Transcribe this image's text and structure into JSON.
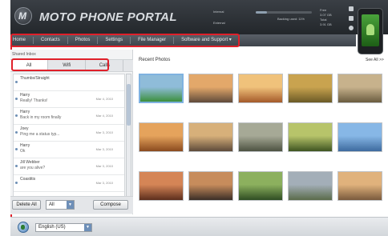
{
  "app": {
    "logo_letter": "M",
    "title": "MOTO PHONE PORTAL"
  },
  "header": {
    "status_label_1": "Internal",
    "status_label_2": "External",
    "meter_text": "Backing used: 11%",
    "meter_fraction": 0.2,
    "storage": [
      "Free",
      "3.07 GB",
      "Total",
      "3.91 GB"
    ]
  },
  "menu": {
    "items": [
      "Home",
      "Contacts",
      "Photos",
      "Settings",
      "File Manager",
      "Software and Support ▾"
    ]
  },
  "messages_pane": {
    "title": "Shared Inbox",
    "tabs": [
      "All",
      "Wifi",
      "Calls"
    ],
    "messages": [
      {
        "name": "Thumbs/Straight",
        "snippet": "",
        "date": ""
      },
      {
        "name": "Harry",
        "snippet": "Really! Thanks!",
        "date": "Mar 4, 2010"
      },
      {
        "name": "Harry",
        "snippet": "Back in my room finally",
        "date": "Mar 4, 2010"
      },
      {
        "name": "Joey",
        "snippet": "Ping me a status typ...",
        "date": "Mar 3, 2010"
      },
      {
        "name": "Harry",
        "snippet": "Ok",
        "date": "Mar 3, 2010"
      },
      {
        "name": "Jill Webber",
        "snippet": "are you alive?",
        "date": "Mar 3, 2010"
      },
      {
        "name": "Coastitis",
        "snippet": "",
        "date": "Mar 3, 2010"
      },
      {
        "name": "",
        "snippet": "",
        "date": ""
      }
    ],
    "delete_all_label": "Delete All",
    "filter_value": "All",
    "compose_label": "Compose"
  },
  "photos": {
    "title": "Recent Photos",
    "see_all": "See All >>",
    "items": [
      {
        "name": "photo-android",
        "colors": [
          "#8fbcd9",
          "#3c8f3c"
        ]
      },
      {
        "name": "photo-dusk-sky",
        "colors": [
          "#e3a86a",
          "#5f4a3a"
        ]
      },
      {
        "name": "photo-city-sunset",
        "colors": [
          "#f0c27b",
          "#a45a2a"
        ]
      },
      {
        "name": "photo-grass-field",
        "colors": [
          "#c9a34f",
          "#6b5a26"
        ]
      },
      {
        "name": "photo-spotted-animal",
        "colors": [
          "#c7b28c",
          "#6a5c3f"
        ]
      },
      {
        "name": "photo-desert-arch",
        "colors": [
          "#e5a35c",
          "#8a4a1e"
        ]
      },
      {
        "name": "photo-tower-city",
        "colors": [
          "#d7b07a",
          "#5d4a3a"
        ]
      },
      {
        "name": "photo-misty-field",
        "colors": [
          "#a6a996",
          "#4d5241"
        ]
      },
      {
        "name": "photo-forest-light",
        "colors": [
          "#b7c46a",
          "#3e5421"
        ]
      },
      {
        "name": "photo-opera-house",
        "colors": [
          "#87b7e6",
          "#3d6a9e"
        ]
      },
      {
        "name": "photo-red-canyon",
        "colors": [
          "#d58556",
          "#5c2e1c"
        ]
      },
      {
        "name": "photo-arches",
        "colors": [
          "#c78c5c",
          "#3a2e26"
        ]
      },
      {
        "name": "photo-daisies",
        "colors": [
          "#8cb05e",
          "#2f4d22"
        ]
      },
      {
        "name": "photo-sky-clouds",
        "colors": [
          "#a3aeb8",
          "#5a6b4a"
        ]
      },
      {
        "name": "photo-mountains",
        "colors": [
          "#e0b27c",
          "#7a5a3c"
        ]
      }
    ]
  },
  "footer": {
    "language": "English (US)"
  }
}
